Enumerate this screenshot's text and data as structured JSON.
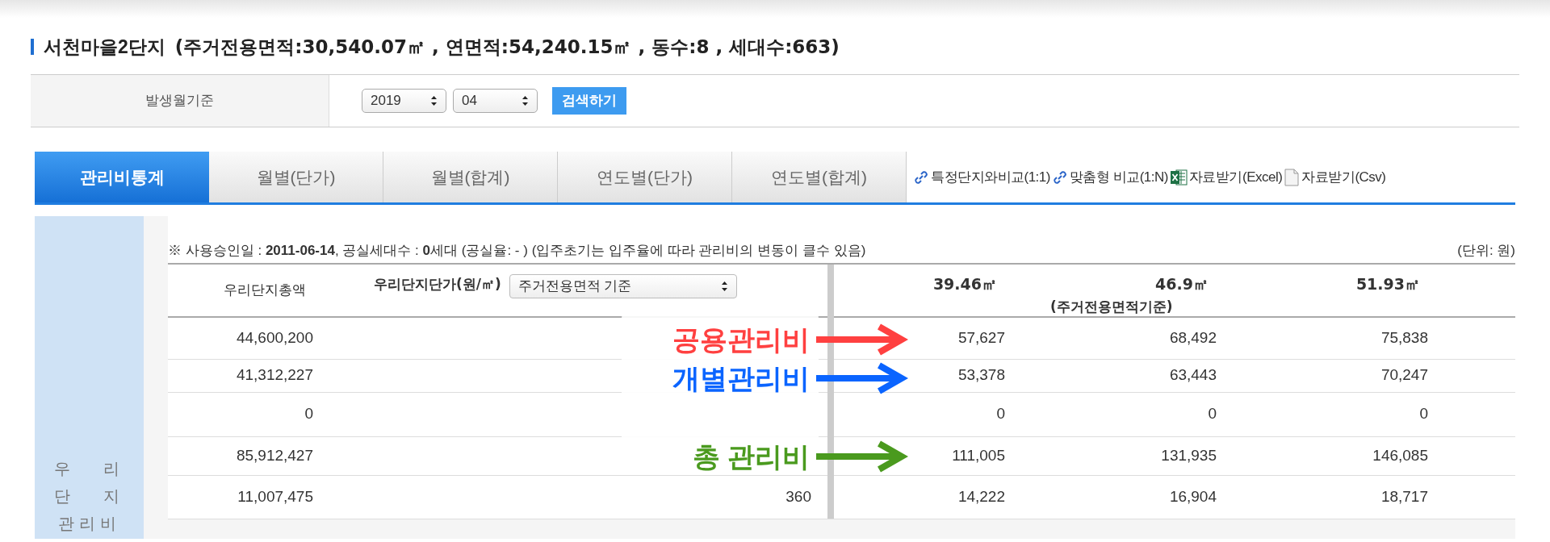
{
  "title": {
    "name": "서천마을2단지",
    "details": "(주거전용면적:30,540.07㎡ , 연면적:54,240.15㎡ , 동수:8 , 세대수:663)"
  },
  "filter": {
    "label": "발생월기준",
    "year": "2019",
    "month": "04",
    "search_button": "검색하기"
  },
  "tabs": [
    {
      "label": "관리비통계",
      "selected": true
    },
    {
      "label": "월별(단가)",
      "selected": false
    },
    {
      "label": "월별(합계)",
      "selected": false
    },
    {
      "label": "연도별(단가)",
      "selected": false
    },
    {
      "label": "연도별(합계)",
      "selected": false
    }
  ],
  "links": [
    {
      "kind": "link",
      "label": "특정단지와비교(1:1)"
    },
    {
      "kind": "link",
      "label": "맞춤형 비교(1:N)"
    },
    {
      "kind": "excel",
      "label": "자료받기(Excel)"
    },
    {
      "kind": "file",
      "label": "자료받기(Csv)"
    }
  ],
  "side_label": [
    "우 리",
    "단 지",
    "관리비"
  ],
  "note": "※ 사용승인일 : **2011-06-14**, 공실세대수 : **0**세대 (공실율: - ) (입주초기는 입주율에 따라 관리비의 변동이 클수 있음)",
  "unit": "(단위: 원)",
  "table": {
    "total_header": "우리단지총액",
    "unit_header": "우리단지단가(원/㎡)",
    "basis_select": "주거전용면적 기준",
    "area_columns": [
      "39.46㎡",
      "46.9㎡",
      "51.93㎡"
    ],
    "area_caption": "(주거전용면적기준)",
    "rows": [
      {
        "total": "44,600,200",
        "values": [
          "57,627",
          "68,492",
          "75,838"
        ]
      },
      {
        "total": "41,312,227",
        "values": [
          "53,378",
          "63,443",
          "70,247"
        ]
      },
      {
        "total": "0",
        "values": [
          "0",
          "0",
          "0"
        ]
      },
      {
        "total": "85,912,427",
        "values": [
          "111,005",
          "131,935",
          "146,085"
        ]
      },
      {
        "total": "11,007,475",
        "unit": "360",
        "values": [
          "14,222",
          "16,904",
          "18,717"
        ]
      }
    ]
  },
  "annotations": [
    {
      "label": "공용관리비",
      "color": "#ff4040"
    },
    {
      "label": "개별관리비",
      "color": "#0a64ff"
    },
    {
      "label": "총 관리비",
      "color": "#4a9a1e"
    }
  ]
}
